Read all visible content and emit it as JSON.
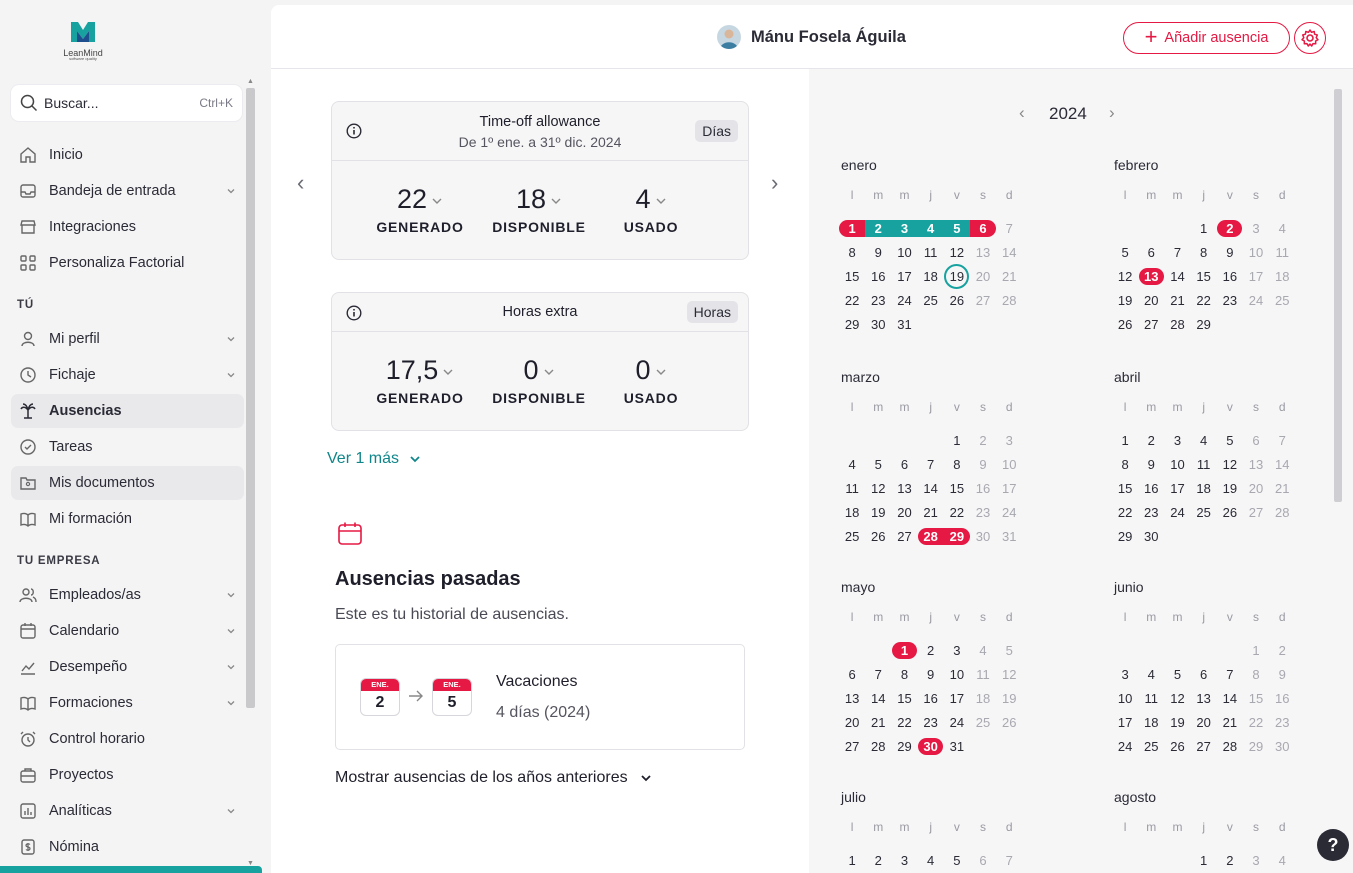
{
  "brand": {
    "name": "LeanMind",
    "tagline": "software quality"
  },
  "search": {
    "placeholder": "Buscar...",
    "shortcut": "Ctrl+K"
  },
  "sidebar": {
    "items": [
      {
        "label": "Inicio"
      },
      {
        "label": "Bandeja de entrada"
      },
      {
        "label": "Integraciones"
      },
      {
        "label": "Personaliza Factorial"
      }
    ],
    "section_you": "TÚ",
    "you_items": [
      {
        "label": "Mi perfil"
      },
      {
        "label": "Fichaje"
      },
      {
        "label": "Ausencias"
      },
      {
        "label": "Tareas"
      },
      {
        "label": "Mis documentos"
      },
      {
        "label": "Mi formación"
      }
    ],
    "section_company": "TU EMPRESA",
    "company_items": [
      {
        "label": "Empleados/as"
      },
      {
        "label": "Calendario"
      },
      {
        "label": "Desempeño"
      },
      {
        "label": "Formaciones"
      },
      {
        "label": "Control horario"
      },
      {
        "label": "Proyectos"
      },
      {
        "label": "Analíticas"
      },
      {
        "label": "Nómina"
      }
    ]
  },
  "header": {
    "user_name": "Mánu Fosela Águila",
    "add_label": "Añadir ausencia"
  },
  "allowance": {
    "title": "Time-off allowance",
    "period": "De 1º ene. a 31º dic. 2024",
    "unit": "Días",
    "stats": [
      {
        "value": "22",
        "label": "GENERADO"
      },
      {
        "value": "18",
        "label": "DISPONIBLE"
      },
      {
        "value": "4",
        "label": "USADO"
      }
    ]
  },
  "overtime": {
    "title": "Horas extra",
    "unit": "Horas",
    "stats": [
      {
        "value": "17,5",
        "label": "GENERADO"
      },
      {
        "value": "0",
        "label": "DISPONIBLE"
      },
      {
        "value": "0",
        "label": "USADO"
      }
    ]
  },
  "more_label": "Ver 1 más",
  "past": {
    "title": "Ausencias pasadas",
    "subtitle": "Este es tu historial de ausencias.",
    "items": [
      {
        "from_month": "ENE.",
        "from_day": "2",
        "to_month": "ENE.",
        "to_day": "5",
        "name": "Vacaciones",
        "duration": "4 días (2024)"
      }
    ],
    "show_previous": "Mostrar ausencias de los años anteriores"
  },
  "calendar": {
    "year": "2024",
    "weekdays": [
      "l",
      "m",
      "m",
      "j",
      "v",
      "s",
      "d"
    ],
    "months": [
      {
        "name": "enero",
        "offset": 0,
        "days": 31,
        "show": 31
      },
      {
        "name": "febrero",
        "offset": 3,
        "days": 29,
        "show": 29
      },
      {
        "name": "marzo",
        "offset": 4,
        "days": 31,
        "show": 31
      },
      {
        "name": "abril",
        "offset": 0,
        "days": 30,
        "show": 30
      },
      {
        "name": "mayo",
        "offset": 2,
        "days": 31,
        "show": 31
      },
      {
        "name": "junio",
        "offset": 5,
        "days": 30,
        "show": 30
      },
      {
        "name": "julio",
        "offset": 0,
        "days": 31,
        "show": 7
      },
      {
        "name": "agosto",
        "offset": 3,
        "days": 31,
        "show": 4
      }
    ],
    "marks": {
      "enero": {
        "1": "redL",
        "2": "teal",
        "3": "teal",
        "4": "teal",
        "5": "teal",
        "6": "redR",
        "19": "today"
      },
      "febrero": {
        "2": "red",
        "13": "red"
      },
      "marzo": {
        "28": "redL",
        "29": "redR"
      },
      "mayo": {
        "1": "red",
        "30": "red"
      }
    },
    "colors": {
      "holiday": "#e51943",
      "vacation": "#17a2a0"
    }
  },
  "help_label": "?"
}
